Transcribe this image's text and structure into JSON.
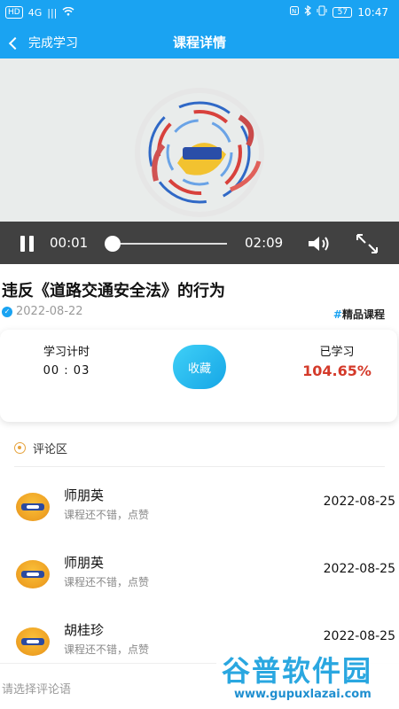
{
  "status_bar": {
    "left_badges": [
      "HD",
      "4G",
      "|||"
    ],
    "battery": "57",
    "time": "10:47"
  },
  "nav": {
    "back_label": "完成学习",
    "title": "课程详情"
  },
  "player": {
    "current_time": "00:01",
    "duration": "02:09",
    "progress_fraction": 0.008
  },
  "course": {
    "title": "违反《道路交通安全法》的行为",
    "date": "2022-08-22",
    "tag": "精品课程"
  },
  "stats": {
    "study_time_label": "学习计时",
    "study_time_value": "00 : 03",
    "favorite_label": "收藏",
    "learned_label": "已学习",
    "learned_value": "104.65%"
  },
  "comments": {
    "header": "评论区",
    "items": [
      {
        "name": "师朋英",
        "text": "课程还不错，点赞",
        "date": "2022-08-25"
      },
      {
        "name": "师朋英",
        "text": "课程还不错，点赞",
        "date": "2022-08-25"
      },
      {
        "name": "胡桂珍",
        "text": "课程还不错，点赞",
        "date": "2022-08-25"
      }
    ]
  },
  "input": {
    "placeholder": "请选择评论语"
  },
  "watermark": {
    "text": "谷普软件园",
    "url": "www.gupuxlazai.com"
  },
  "colors": {
    "brand_blue": "#1aa3f2",
    "progress_red": "#d43a2a",
    "favorite_gradient_start": "#3fd0f7",
    "favorite_gradient_end": "#16a6e6"
  }
}
